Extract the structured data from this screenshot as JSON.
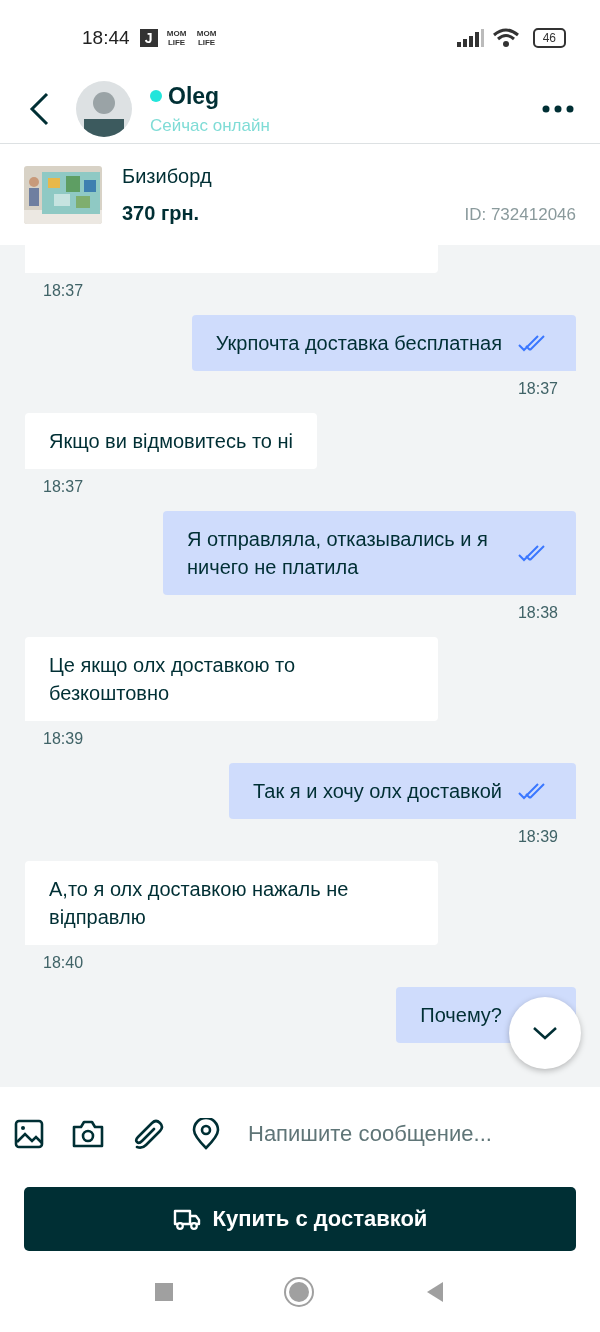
{
  "status_bar": {
    "time": "18:44",
    "notifications": [
      {
        "kind": "box",
        "text": "J"
      },
      {
        "kind": "plain",
        "text": "MOM LIFE"
      },
      {
        "kind": "plain",
        "text": "MOM LIFE"
      }
    ],
    "battery": "46"
  },
  "header": {
    "name": "Oleg",
    "online": true,
    "status": "Сейчас онлайн"
  },
  "product": {
    "title": "Бизиборд",
    "price": "370 грн.",
    "id": "ID: 732412046"
  },
  "messages": [
    {
      "kind": "incoming",
      "time": "18:37"
    },
    {
      "kind": "outgoing",
      "text": "Укрпочта доставка бесплатная",
      "time": "18:37",
      "read": true
    },
    {
      "kind": "incoming",
      "text": "Якщо ви відмовитесь то ні",
      "time": "18:37"
    },
    {
      "kind": "outgoing",
      "text": "Я отправляла, отказывались и я ничего не платила",
      "time": "18:38",
      "read": true
    },
    {
      "kind": "incoming",
      "text": "Це якщо олх доставкою то безкоштовно",
      "time": "18:39"
    },
    {
      "kind": "outgoing",
      "text": "Так я и хочу олх доставкой",
      "time": "18:39",
      "read": true
    },
    {
      "kind": "incoming",
      "text": "А,то я олх доставкою нажаль не відправлю",
      "time": "18:40"
    },
    {
      "kind": "outgoing",
      "text": "Почему?"
    }
  ],
  "composer": {
    "placeholder": "Напишите сообщение..."
  },
  "buy_button": {
    "label": "Купить с доставкой"
  }
}
